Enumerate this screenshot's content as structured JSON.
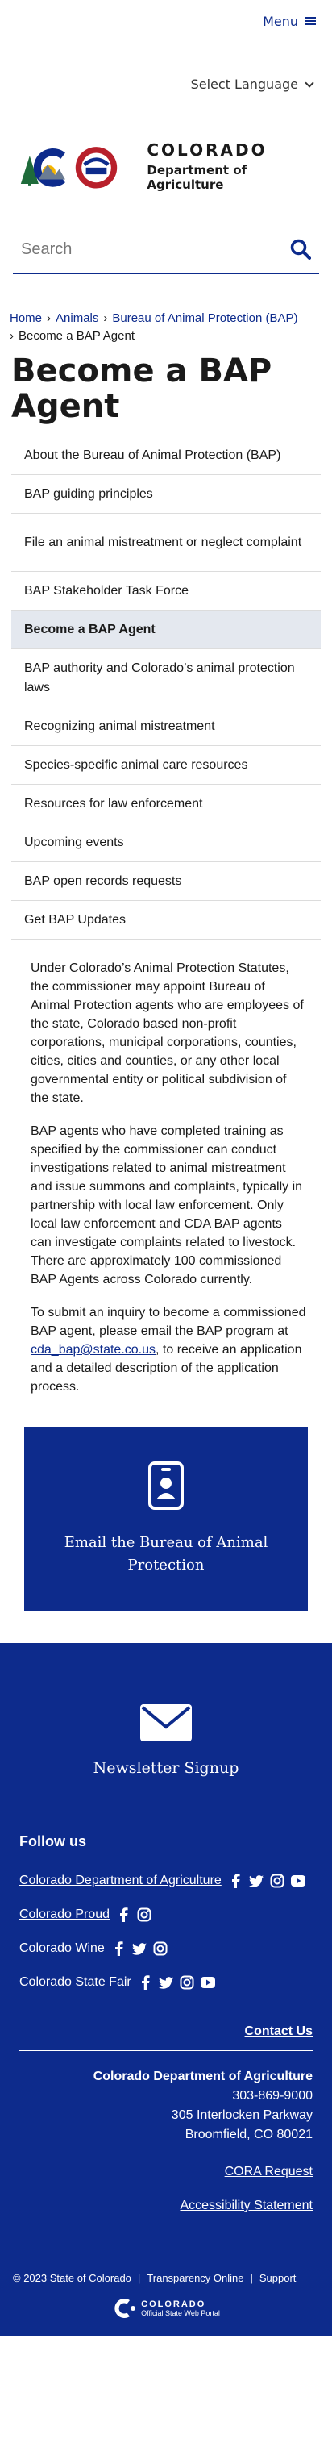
{
  "header": {
    "menu_label": "Menu",
    "language_label": "Select Language",
    "logo": {
      "line1": "COLORADO",
      "line2": "Department of Agriculture",
      "badge": "CDA"
    },
    "search_placeholder": "Search"
  },
  "breadcrumb": {
    "items": [
      "Home",
      "Animals",
      "Bureau of Animal Protection (BAP)"
    ],
    "current": "Become a BAP Agent",
    "separator": "›"
  },
  "page_title": "Become a BAP Agent",
  "side_nav": {
    "items": [
      "About the Bureau of Animal Protection (BAP)",
      "BAP guiding principles",
      "File an animal mistreatment or neglect complaint",
      "BAP Stakeholder Task Force",
      "Become a BAP Agent",
      "BAP authority and Colorado’s animal protection laws",
      "Recognizing animal mistreatment",
      "Species-specific animal care resources",
      "Resources for law enforcement",
      "Upcoming events",
      "BAP open records requests",
      "Get BAP Updates"
    ],
    "active_index": 4
  },
  "content": {
    "p1": "Under Colorado’s Animal Protection Statutes, the commissioner may appoint Bureau of Animal Protection agents who are employees of the state, Colorado based non-profit corporations, municipal corporations, counties, cities, cities and counties, or any other local governmental entity or political subdivision of the state.",
    "p2": "BAP agents who have completed training as specified by the commissioner can conduct investigations related to animal mistreatment and issue summons and complaints, typically in partnership with local law enforcement. Only local law enforcement and CDA BAP agents can investigate complaints related to livestock. There are approximately 100 commissioned BAP Agents across Colorado currently.",
    "p3_before": "To submit an inquiry to become a commissioned BAP agent, please email the BAP program at ",
    "p3_email": "cda_bap@state.co.us",
    "p3_after": ", to receive an application and a detailed description of the application process."
  },
  "cta": {
    "label": "Email the Bureau of Animal Protection"
  },
  "footer": {
    "newsletter_label": "Newsletter Signup",
    "follow_title": "Follow us",
    "social_groups": [
      {
        "name": "Colorado Department of Agriculture"
      },
      {
        "name": "Colorado Proud"
      },
      {
        "name": "Colorado Wine"
      },
      {
        "name": "Colorado State Fair"
      }
    ],
    "contact_label": "Contact Us",
    "address": {
      "org": "Colorado Department of Agriculture",
      "phone": "303-869-9000",
      "street": "305 Interlocken Parkway",
      "city": "Broomfield, CO 80021"
    },
    "cora_label": "CORA Request",
    "accessibility_label": "Accessibility Statement"
  },
  "bottom": {
    "copyright": "© 2023 State of Colorado",
    "transparency": "Transparency Online",
    "support": "Support",
    "portal_line1": "COLORADO",
    "portal_line2": "Official State Web Portal"
  },
  "colors": {
    "brand_blue": "#0d2b8c",
    "active_bg": "#e4e8ef"
  }
}
